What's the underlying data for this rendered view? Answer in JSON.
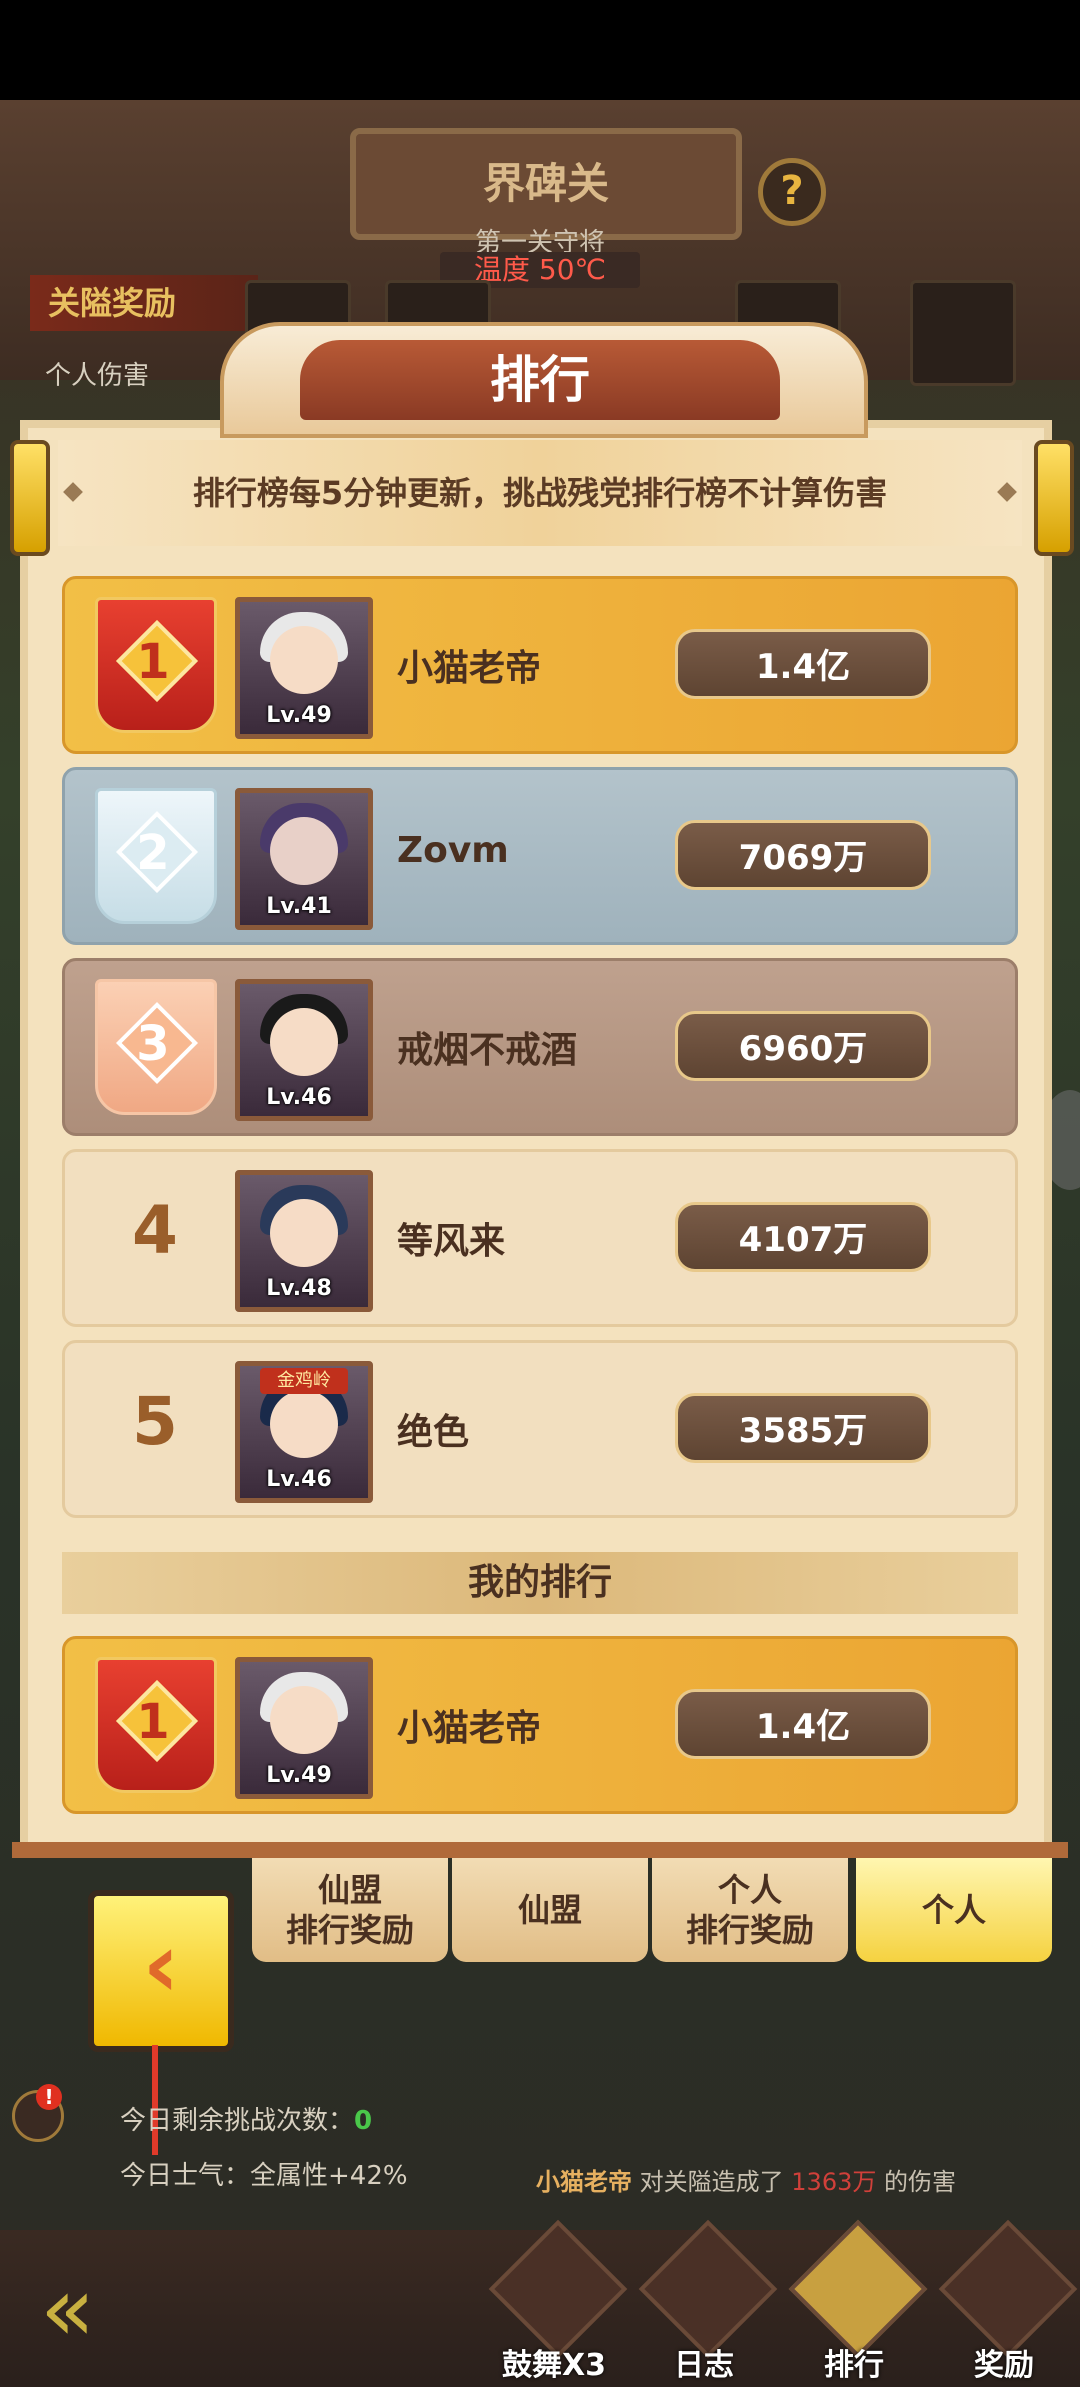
{
  "header": {
    "title": "界碑关",
    "subtitle": "第一关守将",
    "temperature": "温度 50℃",
    "pass_reward_label": "关隘奖励",
    "personal_damage_label": "个人伤害",
    "help_glyph": "?"
  },
  "panel": {
    "title": "排行",
    "notice": "排行榜每5分钟更新，挑战残党排行榜不计算伤害",
    "rows": [
      {
        "rank": "1",
        "name": "小猫老帝",
        "level": "Lv.49",
        "score": "1.4亿",
        "tier": "gold"
      },
      {
        "rank": "2",
        "name": "Zovm",
        "level": "Lv.41",
        "score": "7069万",
        "tier": "silver"
      },
      {
        "rank": "3",
        "name": "戒烟不戒酒",
        "level": "Lv.46",
        "score": "6960万",
        "tier": "bronze"
      },
      {
        "rank": "4",
        "name": "等风来",
        "level": "Lv.48",
        "score": "4107万",
        "tier": "plain"
      },
      {
        "rank": "5",
        "name": "绝色",
        "level": "Lv.46",
        "score": "3585万",
        "tier": "plain",
        "avatar_tag": "金鸡岭"
      }
    ],
    "my_rank_label": "我的排行",
    "my_rank": {
      "rank": "1",
      "name": "小猫老帝",
      "level": "Lv.49",
      "score": "1.4亿"
    }
  },
  "tabs": [
    {
      "label_line1": "仙盟",
      "label_line2": "排行奖励",
      "active": false
    },
    {
      "label_line1": "仙盟",
      "label_line2": "",
      "active": false
    },
    {
      "label_line1": "个人",
      "label_line2": "排行奖励",
      "active": false
    },
    {
      "label_line1": "个人",
      "label_line2": "",
      "active": true
    }
  ],
  "back_button_glyph": "‹",
  "status": {
    "remaining_label": "今日剩余挑战次数：",
    "remaining_value": "0",
    "morale_label": "今日士气：",
    "morale_value": "全属性+42%",
    "damage_player": "小猫老帝",
    "damage_mid": "对关隘造成了",
    "damage_value": "1363万",
    "damage_tail": "的伤害",
    "warn_badge": "!"
  },
  "bottom_nav": [
    {
      "label": "鼓舞X3",
      "icon": "drum-icon"
    },
    {
      "label": "日志",
      "icon": "log-icon"
    },
    {
      "label": "排行",
      "icon": "rank-icon"
    },
    {
      "label": "奖励",
      "icon": "reward-icon"
    }
  ],
  "colors": {
    "gold_row": "#f2bf46",
    "silver_row": "#a9bbc4",
    "bronze_row": "#b79885",
    "plain_row": "#f2dfbf",
    "score_pill": "#6a4e3c",
    "active_tab": "#f5d240"
  }
}
